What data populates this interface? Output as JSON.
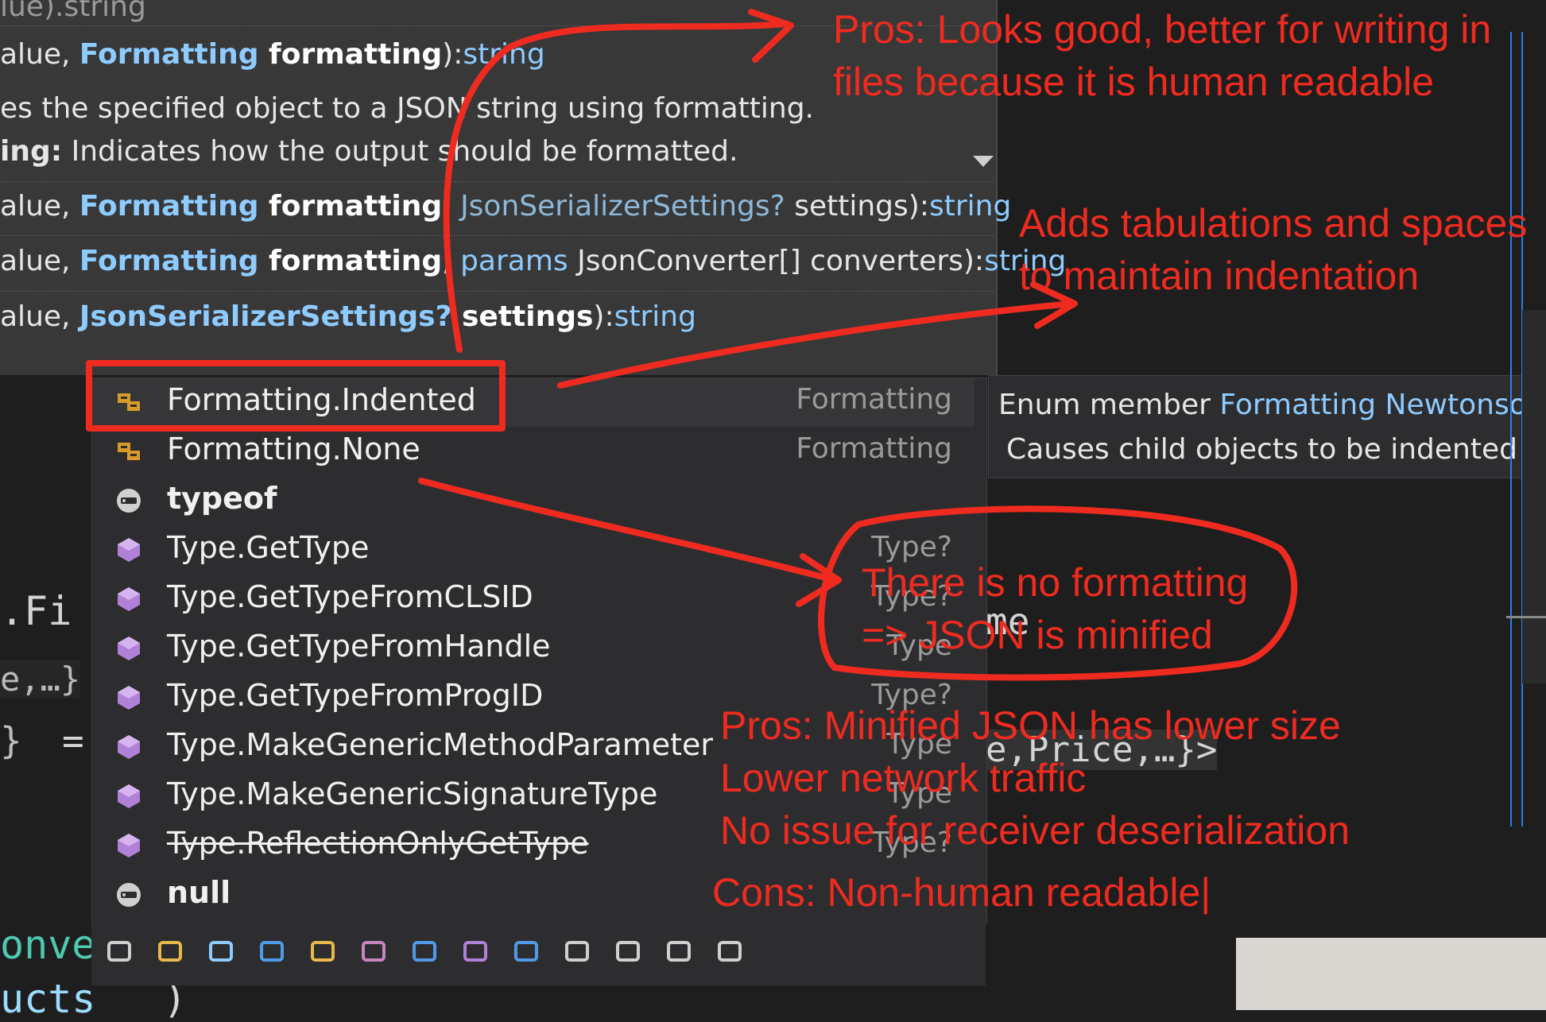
{
  "signatures": {
    "line0_type": "string",
    "line1": {
      "pre": "alue, ",
      "type": "Formatting",
      "param": " formatting",
      "post": "):",
      "ret": "string"
    },
    "desc_line": "es the specified object to a JSON string using formatting.",
    "param_desc": {
      "name": "ing:",
      "text": " Indicates how the output should be formatted."
    },
    "line2": {
      "pre": "alue, ",
      "type": "Formatting",
      "param": " formatting",
      "mid": ", ",
      "type2": "JsonSerializerSettings?",
      "param2": " settings",
      "post": "):",
      "ret": "string"
    },
    "line3": {
      "pre": "alue, ",
      "type": "Formatting",
      "param": " formatting",
      "mid": ", ",
      "kw": "params",
      "type2": " JsonConverter[]",
      "param2": " converters",
      "post": "):",
      "ret": "string"
    },
    "line4": {
      "pre": "alue, ",
      "type": "JsonSerializerSettings?",
      "param": " settings",
      "post": "):",
      "ret": "string"
    }
  },
  "code": {
    "fi": ".Fi",
    "e": "e,…}",
    "brace": "}",
    "eq": "=",
    "onve": "onve",
    "ucts": "ucts",
    "paren": ")",
    "me": "me",
    "price": "e,Price,…}>"
  },
  "completion": {
    "items": [
      {
        "label": "Formatting.Indented",
        "type": "Formatting",
        "icon": "enum-member-icon",
        "selected": true
      },
      {
        "label": "Formatting.None",
        "type": "Formatting",
        "icon": "enum-member-icon"
      },
      {
        "label": "typeof",
        "type": "",
        "icon": "keyword-icon",
        "bold": true
      },
      {
        "label": "Type.GetType",
        "type": "Type?",
        "icon": "method-icon"
      },
      {
        "label": "Type.GetTypeFromCLSID",
        "type": "Type?",
        "icon": "method-icon"
      },
      {
        "label": "Type.GetTypeFromHandle",
        "type": "Type",
        "icon": "method-icon"
      },
      {
        "label": "Type.GetTypeFromProgID",
        "type": "Type?",
        "icon": "method-icon"
      },
      {
        "label": "Type.MakeGenericMethodParameter",
        "type": "Type",
        "icon": "method-icon"
      },
      {
        "label": "Type.MakeGenericSignatureType",
        "type": "Type",
        "icon": "method-icon"
      },
      {
        "label": "Type.ReflectionOnlyGetType",
        "type": "Type?",
        "icon": "method-icon",
        "strike": true
      },
      {
        "label": "null",
        "type": "",
        "icon": "keyword-icon",
        "bold": true
      }
    ],
    "filters": [
      "namespace-filter-icon",
      "class-filter-icon",
      "field-filter-icon",
      "interface-filter-icon",
      "enum-filter-icon",
      "struct-filter-icon",
      "delegate-filter-icon",
      "method-filter-icon",
      "property-filter-icon",
      "event-filter-icon",
      "group-filter-icon",
      "extension-filter-icon",
      "lock-filter-icon"
    ]
  },
  "tooltip": {
    "l1_pre": "Enum member ",
    "l1_type": "Formatting",
    "l1_ns": " Newtonsoft.",
    "l2": "Causes child objects to be indented acc"
  },
  "annotations": {
    "pros_readable_1": "Pros: Looks good, better for writing in",
    "pros_readable_2": "files because it is human readable",
    "adds_1": "Adds tabulations and spaces",
    "adds_2": "to maintain indentation",
    "none_1": "There is no formatting",
    "none_2": "=> JSON is minified",
    "pros_min_1": "Pros: Minified JSON has lower size",
    "pros_min_2": "Lower network traffic",
    "pros_min_3": "No issue for receiver deserialization",
    "cons": "Cons: Non-human readable|"
  },
  "colors": {
    "annotation": "#ef2b20",
    "accent": "#8ecbff",
    "panel": "#2d2d30"
  }
}
